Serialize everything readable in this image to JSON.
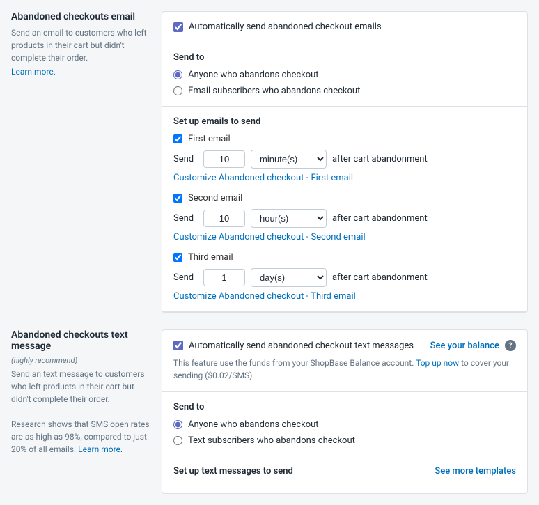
{
  "email_section": {
    "title": "Abandoned checkouts email",
    "description": "Send an email to customers who left products in their cart but didn't complete their order.",
    "learn_more_label": "Learn more.",
    "auto_send_label": "Automatically send abandoned checkout emails",
    "send_to": {
      "title": "Send to",
      "options": [
        {
          "label": "Anyone who abandons checkout",
          "value": "anyone",
          "checked": true
        },
        {
          "label": "Email subscribers who abandons checkout",
          "value": "subscribers",
          "checked": false
        }
      ]
    },
    "setup_emails": {
      "title": "Set up emails to send",
      "emails": [
        {
          "id": "first",
          "label": "First email",
          "checked": true,
          "send_value": "10",
          "time_unit": "minute(s)",
          "time_options": [
            "minute(s)",
            "hour(s)",
            "day(s)"
          ],
          "after_text": "after cart abandonment",
          "customize_label": "Customize Abandoned checkout - First email"
        },
        {
          "id": "second",
          "label": "Second email",
          "checked": true,
          "send_value": "10",
          "time_unit": "hour(s)",
          "time_options": [
            "minute(s)",
            "hour(s)",
            "day(s)"
          ],
          "after_text": "after cart abandonment",
          "customize_label": "Customize Abandoned checkout - Second email"
        },
        {
          "id": "third",
          "label": "Third email",
          "checked": true,
          "send_value": "1",
          "time_unit": "day(s)",
          "time_options": [
            "minute(s)",
            "hour(s)",
            "day(s)"
          ],
          "after_text": "after cart abandonment",
          "customize_label": "Customize Abandoned checkout - Third email"
        }
      ]
    }
  },
  "sms_section": {
    "title": "Abandoned checkouts text message",
    "highly_recommend": "(highly recommend)",
    "description": "Send an text message to customers who left products in their cart but didn't complete their order.\nResearch shows that SMS open rates are as high as 98%, compared to just 20% of all emails.",
    "learn_more_label": "Learn more.",
    "auto_send_label": "Automatically send abandoned checkout text messages",
    "see_balance_label": "See your balance",
    "info_text": "This feature use the funds from your ShopBase Balance account.",
    "topup_label": "Top up now",
    "topup_suffix": "to cover your sending ($0.02/SMS)",
    "send_to": {
      "title": "Send to",
      "options": [
        {
          "label": "Anyone who abandons checkout",
          "value": "anyone",
          "checked": true
        },
        {
          "label": "Text subscribers who abandons checkout",
          "value": "subscribers",
          "checked": false
        }
      ]
    },
    "setup_texts": {
      "title": "Set up text messages to send",
      "see_more_label": "See more templates"
    }
  }
}
